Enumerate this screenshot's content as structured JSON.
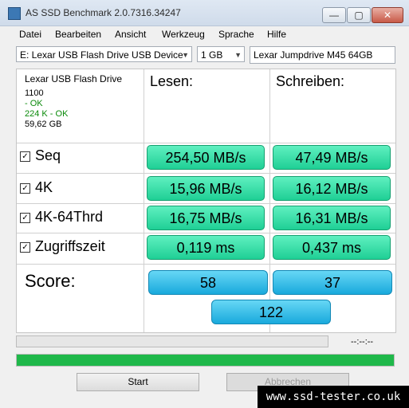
{
  "window": {
    "title": "AS SSD Benchmark 2.0.7316.34247",
    "minimize": "—",
    "maximize": "▢",
    "close": "✕"
  },
  "menu": [
    "Datei",
    "Bearbeiten",
    "Ansicht",
    "Werkzeug",
    "Sprache",
    "Hilfe"
  ],
  "toolbar": {
    "drive_select": "E: Lexar USB Flash Drive USB Device",
    "size_select": "1 GB",
    "drive_label": "Lexar Jumpdrive M45 64GB"
  },
  "info": {
    "name": "Lexar USB Flash Drive",
    "firmware": "1100",
    "status1": " - OK",
    "status2": "224 K - OK",
    "capacity": "59,62 GB"
  },
  "headers": {
    "read": "Lesen:",
    "write": "Schreiben:"
  },
  "tests": [
    {
      "label": "Seq",
      "checked": "☑",
      "read": "254,50 MB/s",
      "write": "47,49 MB/s"
    },
    {
      "label": "4K",
      "checked": "☑",
      "read": "15,96 MB/s",
      "write": "16,12 MB/s"
    },
    {
      "label": "4K-64Thrd",
      "checked": "☑",
      "read": "16,75 MB/s",
      "write": "16,31 MB/s"
    },
    {
      "label": "Zugriffszeit",
      "checked": "☑",
      "read": "0,119 ms",
      "write": "0,437 ms"
    }
  ],
  "score": {
    "label": "Score:",
    "read": "58",
    "write": "37",
    "total": "122"
  },
  "progress": {
    "time": "--:--:--",
    "bottom_fill_fraction": 1.0,
    "bar_color": "#1fb84a"
  },
  "buttons": {
    "start": "Start",
    "abort": "Abbrechen"
  },
  "watermark": "www.ssd-tester.co.uk",
  "colors": {
    "result_green": "#2ad8a0",
    "score_blue": "#2bb5e3"
  }
}
